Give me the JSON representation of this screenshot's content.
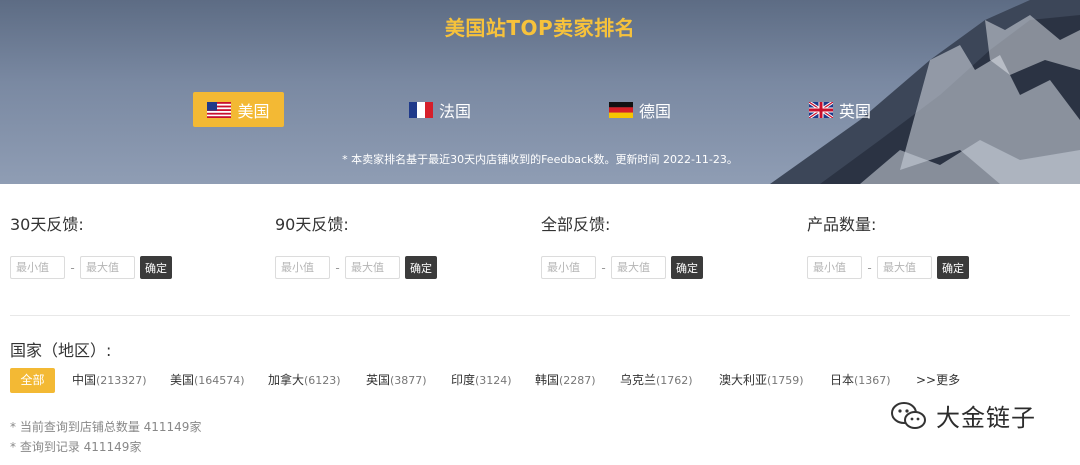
{
  "banner": {
    "title": "美国站TOP卖家排名",
    "note": "* 本卖家排名基于最近30天内店铺收到的Feedback数。更新时间 2022-11-23。",
    "tabs": [
      {
        "label": "美国",
        "flag": "us-flag-icon",
        "active": true
      },
      {
        "label": "法国",
        "flag": "fr-flag-icon",
        "active": false
      },
      {
        "label": "德国",
        "flag": "de-flag-icon",
        "active": false
      },
      {
        "label": "英国",
        "flag": "uk-flag-icon",
        "active": false
      }
    ]
  },
  "filters": [
    {
      "label": "30天反馈:",
      "min_placeholder": "最小值",
      "max_placeholder": "最大值",
      "confirm": "确定"
    },
    {
      "label": "90天反馈:",
      "min_placeholder": "最小值",
      "max_placeholder": "最大值",
      "confirm": "确定"
    },
    {
      "label": "全部反馈:",
      "min_placeholder": "最小值",
      "max_placeholder": "最大值",
      "confirm": "确定"
    },
    {
      "label": "产品数量:",
      "min_placeholder": "最小值",
      "max_placeholder": "最大值",
      "confirm": "确定"
    }
  ],
  "dash": "-",
  "country": {
    "label": "国家（地区）:",
    "all_label": "全部",
    "items": [
      {
        "name": "中国",
        "count": "(213327)"
      },
      {
        "name": "美国",
        "count": "(164574)"
      },
      {
        "name": "加拿大",
        "count": "(6123)"
      },
      {
        "name": "英国",
        "count": "(3877)"
      },
      {
        "name": "印度",
        "count": "(3124)"
      },
      {
        "name": "韩国",
        "count": "(2287)"
      },
      {
        "name": "乌克兰",
        "count": "(1762)"
      },
      {
        "name": "澳大利亚",
        "count": "(1759)"
      },
      {
        "name": "日本",
        "count": "(1367)"
      }
    ],
    "more_label": ">>更多"
  },
  "stats": {
    "total": "* 当前查询到店铺总数量 411149家",
    "records": "* 查询到记录 411149家"
  },
  "watermark": {
    "icon": "wechat-icon",
    "text": "大金链子"
  },
  "colors": {
    "accent": "#f3b934",
    "title": "#f7c23b",
    "button_dark": "#3b3b3b"
  }
}
